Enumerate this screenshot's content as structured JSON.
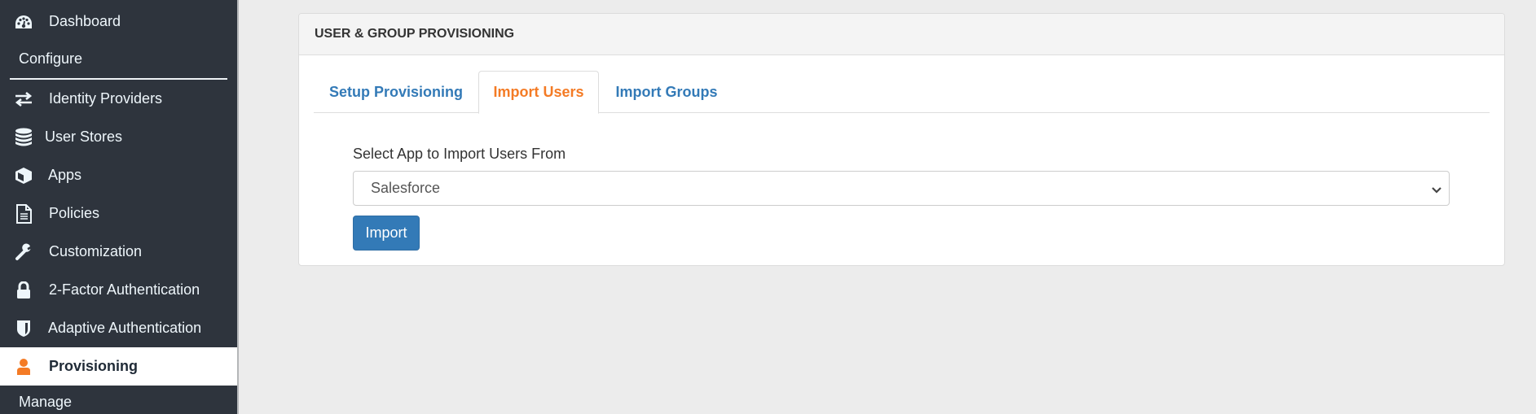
{
  "sidebar": {
    "items": [
      {
        "label": "Dashboard",
        "icon": "dashboard-icon"
      },
      {
        "label": "Identity Providers",
        "icon": "exchange-arrows-icon"
      },
      {
        "label": "User Stores",
        "icon": "database-icon"
      },
      {
        "label": "Apps",
        "icon": "cube-icon"
      },
      {
        "label": "Policies",
        "icon": "document-icon"
      },
      {
        "label": "Customization",
        "icon": "wrench-icon"
      },
      {
        "label": "2-Factor Authentication",
        "icon": "lock-icon"
      },
      {
        "label": "Adaptive Authentication",
        "icon": "shield-icon"
      },
      {
        "label": "Provisioning",
        "icon": "user-icon",
        "active": true
      }
    ],
    "sections": {
      "configure": "Configure",
      "manage": "Manage"
    }
  },
  "panel": {
    "title": "USER & GROUP PROVISIONING",
    "tabs": [
      {
        "label": "Setup Provisioning",
        "active": false
      },
      {
        "label": "Import Users",
        "active": true
      },
      {
        "label": "Import Groups",
        "active": false
      }
    ],
    "form": {
      "label": "Select App to Import Users From",
      "selected_value": "Salesforce",
      "button_label": "Import"
    }
  },
  "colors": {
    "sidebar_bg": "#2e343d",
    "accent_orange": "#f47b25",
    "link_blue": "#337ab7",
    "button_blue": "#337ab7"
  }
}
